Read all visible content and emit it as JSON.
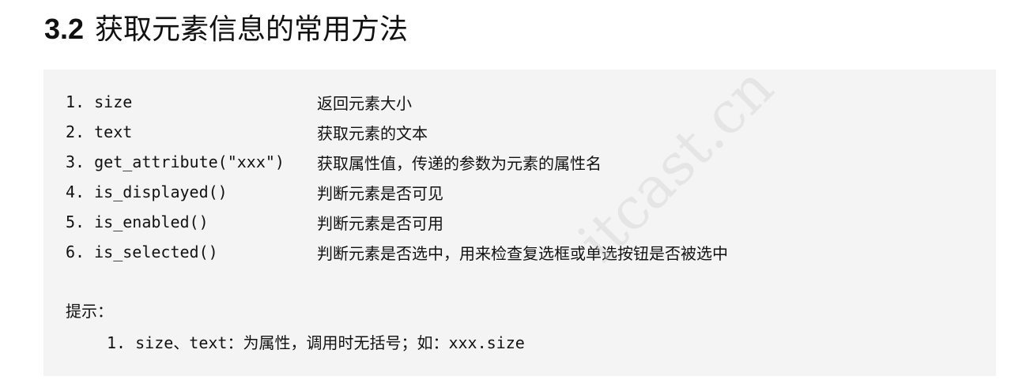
{
  "heading": {
    "number": "3.2",
    "text": "获取元素信息的常用方法"
  },
  "methods": [
    {
      "code": "1. size",
      "desc": "返回元素大小"
    },
    {
      "code": "2. text",
      "desc": "获取元素的文本"
    },
    {
      "code": "3. get_attribute(\"xxx\")",
      "desc": "获取属性值，传递的参数为元素的属性名"
    },
    {
      "code": "4. is_displayed()",
      "desc": "判断元素是否可见"
    },
    {
      "code": "5. is_enabled()",
      "desc": "判断元素是否可用"
    },
    {
      "code": "6. is_selected()",
      "desc": "判断元素是否选中，用来检查复选框或单选按钮是否被选中"
    }
  ],
  "tip": {
    "label": "提示：",
    "item": "1. size、text：为属性，调用时无括号；如：xxx.size"
  },
  "watermark": "itcast.cn"
}
